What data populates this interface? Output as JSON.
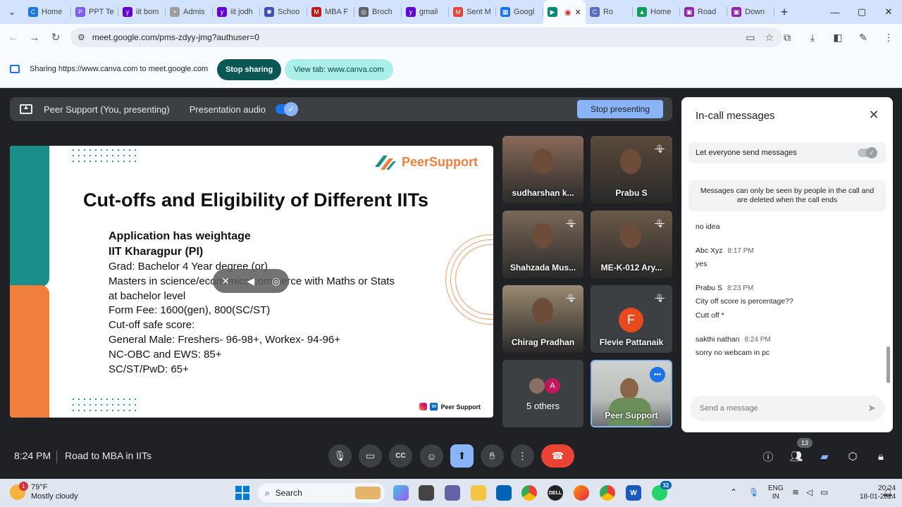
{
  "browser": {
    "tabs": [
      {
        "label": "Home",
        "color": "#1a73e8",
        "glyph": "C"
      },
      {
        "label": "PPT Te",
        "color": "#7b5cff",
        "glyph": "P"
      },
      {
        "label": "iit bom",
        "color": "#6001d2",
        "glyph": "y"
      },
      {
        "label": "Admis",
        "color": "#9e9e9e",
        "glyph": "•"
      },
      {
        "label": "iit jodh",
        "color": "#6001d2",
        "glyph": "y"
      },
      {
        "label": "Schoo",
        "color": "#3f51b5",
        "glyph": "✱"
      },
      {
        "label": "MBA F",
        "color": "#b71c1c",
        "glyph": "M"
      },
      {
        "label": "Broch",
        "color": "#5f6368",
        "glyph": "◎"
      },
      {
        "label": "gmail",
        "color": "#6001d2",
        "glyph": "y"
      },
      {
        "label": "Sent M",
        "color": "#ea4335",
        "glyph": "M"
      },
      {
        "label": "Googl",
        "color": "#1a73e8",
        "glyph": "▦"
      },
      {
        "label": "",
        "color": "#00897b",
        "glyph": "▶",
        "active": true
      },
      {
        "label": "Ro",
        "color": "#5c6bc0",
        "glyph": "C"
      },
      {
        "label": "Home",
        "color": "#0f9d58",
        "glyph": "▲"
      },
      {
        "label": "Road",
        "color": "#8e24aa",
        "glyph": "▣"
      },
      {
        "label": "Down",
        "color": "#8e24aa",
        "glyph": "▣"
      }
    ],
    "new_tab": "+",
    "url": "meet.google.com/pms-zdyy-jmg?authuser=0"
  },
  "sharebar": {
    "text": "Sharing https://www.canva.com to meet.google.com",
    "stop_label": "Stop sharing",
    "view_label": "View tab: www.canva.com"
  },
  "presenting": {
    "label": "Peer Support (You, presenting)",
    "audio_label": "Presentation audio",
    "audio_on": true,
    "stop_label": "Stop presenting"
  },
  "slide": {
    "logo": "PeerSupport",
    "title": "Cut-offs and Eligibility of Different IITs",
    "bold_lines": [
      "Application has weightage",
      "IIT Kharagpur (PI)"
    ],
    "lines": [
      "Grad: Bachelor 4 Year degree (or)",
      "Masters in science/economics/commerce with Maths or Stats",
      "at bachelor level",
      "Form Fee: 1600(gen), 800(SC/ST)",
      "Cut-off safe score:",
      "General Male: Freshers- 96-98+, Workex- 94-96+",
      "NC-OBC and EWS: 85+",
      "SC/ST/PwD: 65+"
    ],
    "footer": "Peer Support"
  },
  "participants": [
    {
      "name": "sudharshan k...",
      "muted": false,
      "bg": "#8a6a58"
    },
    {
      "name": "Prabu S",
      "muted": true,
      "bg": "#5a4a3a"
    },
    {
      "name": "Shahzada Mus...",
      "muted": true,
      "bg": "#7a6858"
    },
    {
      "name": "ME-K-012 Ary...",
      "muted": true,
      "bg": "#6b5a48"
    },
    {
      "name": "Chirag Pradhan",
      "muted": true,
      "bg": "#9a8a70"
    },
    {
      "name": "Flevie Pattanaik",
      "muted": true,
      "avatar": "F"
    }
  ],
  "others": {
    "label": "5 others",
    "avatar": "A"
  },
  "self_tile": {
    "name": "Peer Support",
    "more": "•••"
  },
  "chat": {
    "title": "In-call messages",
    "setting_label": "Let everyone send messages",
    "notice": "Messages can only be seen by people in the call and are deleted when the call ends",
    "messages": [
      {
        "sender": "",
        "time": "",
        "texts": [
          "no idea"
        ]
      },
      {
        "sender": "Abc Xyz",
        "time": "8:17 PM",
        "texts": [
          "yes"
        ]
      },
      {
        "sender": "Prabu S",
        "time": "8:23 PM",
        "texts": [
          "City off score is percentage??",
          "Cutt off *"
        ]
      },
      {
        "sender": "sakthi nathan",
        "time": "8:24 PM",
        "texts": [
          "sorry no webcam in pc"
        ]
      }
    ],
    "input_placeholder": "Send a message"
  },
  "meetbar": {
    "time": "8:24 PM",
    "meeting_name": "Road to MBA in IITs",
    "people_count": "13"
  },
  "taskbar": {
    "weather_badge": "1",
    "temperature": "79°F",
    "weather": "Mostly cloudy",
    "search_placeholder": "Search",
    "whatsapp_badge": "32",
    "lang_line1": "ENG",
    "lang_line2": "IN",
    "time": "20:24",
    "date": "18-01-2024"
  }
}
